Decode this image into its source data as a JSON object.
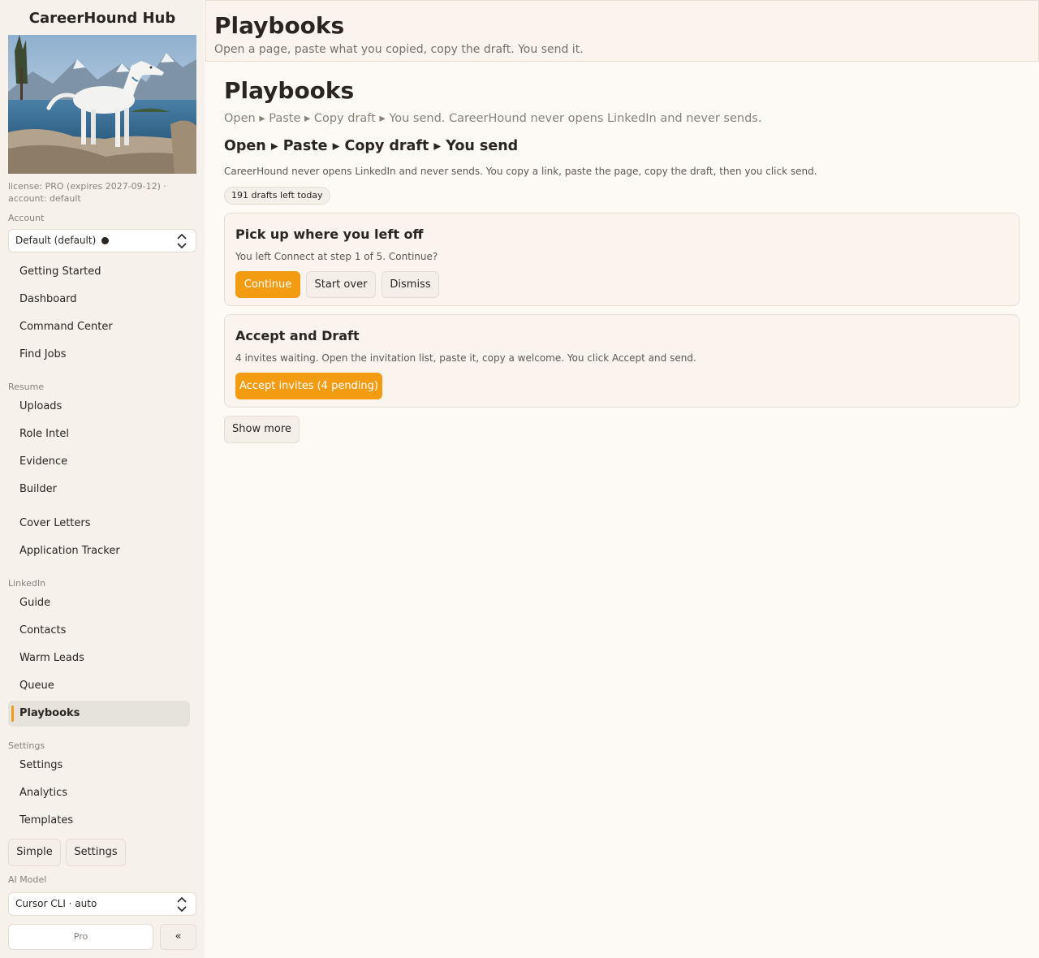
{
  "app": {
    "title": "CareerHound Hub"
  },
  "license": {
    "text": "license: PRO (expires 2027-09-12) · account: default"
  },
  "account": {
    "label": "Account",
    "value": "Default (default)"
  },
  "nav": {
    "top": [
      "Getting Started",
      "Dashboard",
      "Command Center",
      "Find Jobs"
    ],
    "resume_label": "Resume",
    "resume": [
      "Uploads",
      "Role Intel",
      "Evidence",
      "Builder"
    ],
    "misc": [
      "Cover Letters",
      "Application Tracker"
    ],
    "linkedin_label": "LinkedIn",
    "linkedin": [
      "Guide",
      "Contacts",
      "Warm Leads",
      "Queue",
      "Playbooks"
    ],
    "settings_label": "Settings",
    "settings": [
      "Settings",
      "Analytics",
      "Templates"
    ]
  },
  "mode_buttons": {
    "simple": "Simple",
    "settings": "Settings"
  },
  "ai_model": {
    "label": "AI Model",
    "value": "Cursor CLI · auto"
  },
  "footer": {
    "pro": "Pro",
    "collapse": "«"
  },
  "header": {
    "title": "Playbooks",
    "subtitle": "Open a page, paste what you copied, copy the draft. You send it."
  },
  "main": {
    "title": "Playbooks",
    "subtitle": "Open ▸ Paste ▸ Copy draft ▸ You send. CareerHound never opens LinkedIn and never sends.",
    "flow_title": "Open ▸ Paste ▸ Copy draft ▸ You send",
    "flow_desc": "CareerHound never opens LinkedIn and never sends. You copy a link, paste the page, copy the draft, then you click send.",
    "drafts_left": "191 drafts left today"
  },
  "resume_card": {
    "title": "Pick up where you left off",
    "desc": "You left Connect at step 1 of 5. Continue?",
    "continue": "Continue",
    "start_over": "Start over",
    "dismiss": "Dismiss"
  },
  "accept_card": {
    "title": "Accept and Draft",
    "desc": "4 invites waiting. Open the invitation list, paste it, copy a welcome. You click Accept and send.",
    "button": "Accept invites (4 pending)"
  },
  "show_more": "Show more",
  "colors": {
    "accent": "#f39c12",
    "active_bar": "#f19a1c",
    "background": "#fdfaf5",
    "sidebar": "#f6f1ea"
  }
}
